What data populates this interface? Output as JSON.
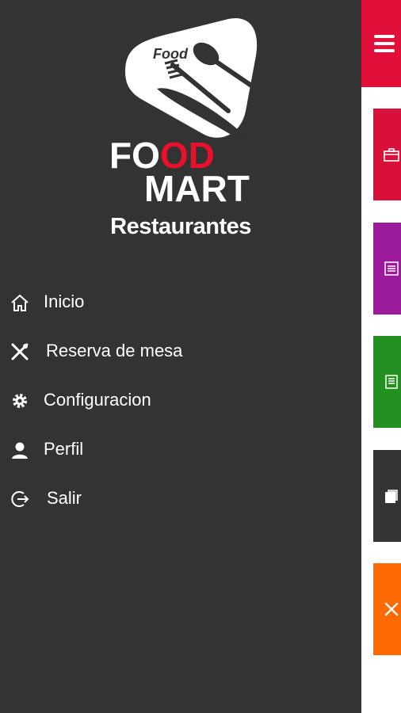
{
  "app": {
    "brand_line1": "FOOD",
    "brand_line2": "MART",
    "logo_tag": "Food",
    "subtitle": "Restaurantes"
  },
  "menu": [
    {
      "label": "Inicio",
      "icon": "home-icon"
    },
    {
      "label": "Reserva de mesa",
      "icon": "fork-knife-icon"
    },
    {
      "label": "Configuracion",
      "icon": "gear-icon"
    },
    {
      "label": "Perfil",
      "icon": "user-icon"
    },
    {
      "label": "Salir",
      "icon": "logout-icon"
    }
  ],
  "background_app": {
    "topbar_icon": "hamburger-menu-icon",
    "tiles": [
      {
        "color": "#d8103a",
        "icon": "briefcase-icon"
      },
      {
        "color": "#9c1a9c",
        "icon": "list-icon"
      },
      {
        "color": "#23901f",
        "icon": "document-icon"
      },
      {
        "color": "#343434",
        "icon": "notes-icon"
      },
      {
        "color": "#ff6a00",
        "icon": "fork-knife-icon"
      }
    ]
  },
  "colors": {
    "drawer_bg": "#333333",
    "topbar": "#e0103a",
    "brand_accent": "#e8102a",
    "text": "#ffffff"
  }
}
